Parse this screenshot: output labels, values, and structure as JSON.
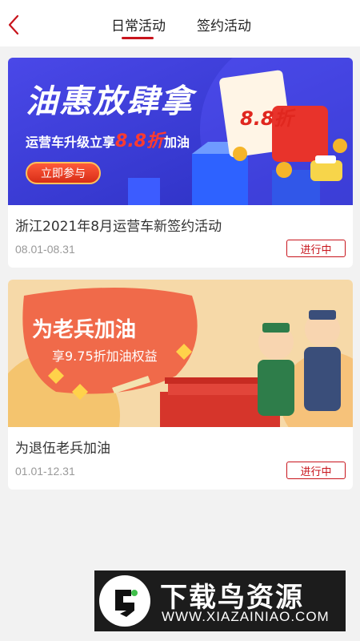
{
  "header": {
    "tabs": [
      {
        "label": "日常活动",
        "active": true
      },
      {
        "label": "签约活动",
        "active": false
      }
    ],
    "accent_color": "#c8141c"
  },
  "activities": [
    {
      "title": "浙江2021年8月运营车新签约活动",
      "date_range": "08.01-08.31",
      "status": "进行中",
      "banner": {
        "headline": "油惠放肆拿",
        "subline_prefix": "运营车升级立享",
        "subline_highlight": "8.8折",
        "subline_suffix": "加油",
        "button": "立即参与",
        "discount_tag": "8.8折"
      }
    },
    {
      "title": "为退伍老兵加油",
      "date_range": "01.01-12.31",
      "status": "进行中",
      "banner": {
        "headline": "为老兵加油",
        "subline": "享9.75折加油权益"
      }
    }
  ],
  "watermark": {
    "name": "下载鸟资源",
    "url": "WWW.XIAZAINIAO.COM"
  }
}
